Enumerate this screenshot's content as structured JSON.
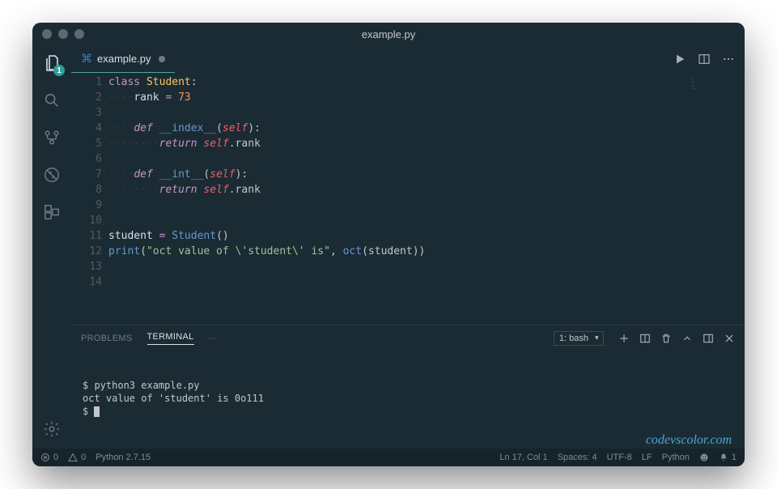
{
  "window": {
    "title": "example.py"
  },
  "activity": {
    "explorer_badge": "1"
  },
  "tab": {
    "filename": "example.py"
  },
  "code": {
    "lines": [
      {
        "n": "1",
        "html": "<span class='kw-class'>class</span> <span class='cls'>Student</span>:"
      },
      {
        "n": "2",
        "html": "<span class='ind'>····</span><span class='var'>rank</span> <span class='op'>=</span> <span class='num'>73</span>"
      },
      {
        "n": "3",
        "html": ""
      },
      {
        "n": "4",
        "html": "<span class='ind'>····</span><span class='kw-def'>def</span> <span class='fn'>__index__</span>(<span class='self'>self</span>):"
      },
      {
        "n": "5",
        "html": "<span class='ind'>········</span><span class='kw-return'>return</span> <span class='self'>self</span>.rank"
      },
      {
        "n": "6",
        "html": ""
      },
      {
        "n": "7",
        "html": "<span class='ind'>····</span><span class='kw-def'>def</span> <span class='fn'>__int__</span>(<span class='self'>self</span>):"
      },
      {
        "n": "8",
        "html": "<span class='ind'>········</span><span class='kw-return'>return</span> <span class='self'>self</span>.rank"
      },
      {
        "n": "9",
        "html": ""
      },
      {
        "n": "10",
        "html": ""
      },
      {
        "n": "11",
        "html": "<span class='var'>student</span> <span class='op'>=</span> <span class='fn'>Student</span>()"
      },
      {
        "n": "12",
        "html": "<span class='fn'>print</span>(<span class='str'>\"oct value of \\'student\\' is\"</span>, <span class='fn'>oct</span>(student))"
      },
      {
        "n": "13",
        "html": ""
      },
      {
        "n": "14",
        "html": ""
      }
    ]
  },
  "panel": {
    "tabs": {
      "problems": "PROBLEMS",
      "terminal": "TERMINAL"
    },
    "term_select": "1: bash",
    "terminal_lines": [
      "$ python3 example.py",
      "oct value of 'student' is 0o111",
      "$ "
    ]
  },
  "watermark": "codevscolor.com",
  "status": {
    "errors": "0",
    "warnings": "0",
    "python_version": "Python 2.7.15",
    "position": "Ln 17, Col 1",
    "spaces": "Spaces: 4",
    "encoding": "UTF-8",
    "eol": "LF",
    "language": "Python",
    "notifications": "1"
  }
}
